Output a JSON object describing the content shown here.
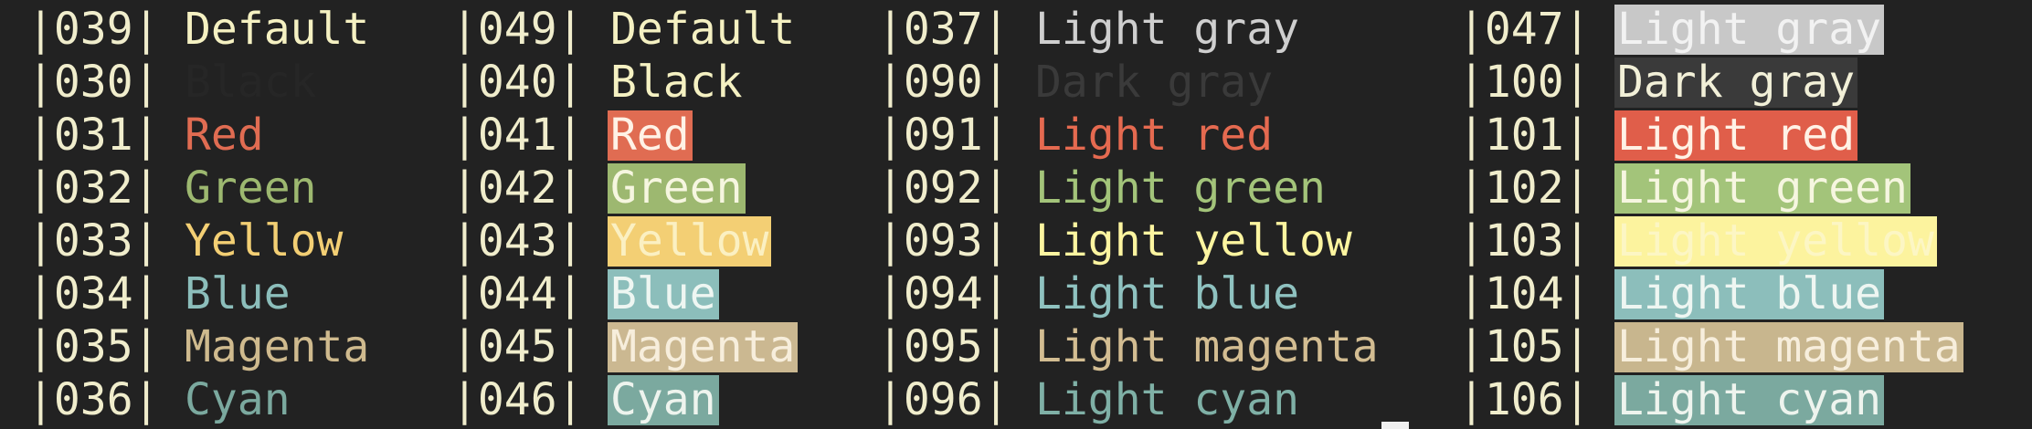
{
  "terminal": {
    "background": "#222222",
    "rows": [
      {
        "fg_code": "|039|",
        "fg_label": "Default",
        "fg_color": "#f5f1c2",
        "bg_code": "|049|",
        "bg_label": "Default",
        "bg_color": "#222222",
        "bg_text": "#f5f1c2",
        "lfg_code": "|037|",
        "lfg_label": "Light gray",
        "lfg_color": "#cfcfcf",
        "lbg_code": "|047|",
        "lbg_label": "Light gray",
        "lbg_color": "#c8c8c8",
        "lbg_text": "#f2f2f2"
      },
      {
        "fg_code": "|030|",
        "fg_label": "Black",
        "fg_color": "#262626",
        "bg_code": "|040|",
        "bg_label": "Black",
        "bg_color": "#222222",
        "bg_text": "#f5f1c2",
        "lfg_code": "|090|",
        "lfg_label": "Dark gray",
        "lfg_color": "#3a3a3a",
        "lbg_code": "|100|",
        "lbg_label": "Dark gray",
        "lbg_color": "#3a3a3a",
        "lbg_text": "#f2f0d8"
      },
      {
        "fg_code": "|031|",
        "fg_label": "Red",
        "fg_color": "#e06c52",
        "bg_code": "|041|",
        "bg_label": "Red",
        "bg_color": "#e06c52",
        "bg_text": "#fff2e6",
        "lfg_code": "|091|",
        "lfg_label": "Light red",
        "lfg_color": "#e56a50",
        "lbg_code": "|101|",
        "lbg_label": "Light red",
        "lbg_color": "#e05e4a",
        "lbg_text": "#fff2e6"
      },
      {
        "fg_code": "|032|",
        "fg_label": "Green",
        "fg_color": "#9db870",
        "bg_code": "|042|",
        "bg_label": "Green",
        "bg_color": "#9db870",
        "bg_text": "#f6f6e0",
        "lfg_code": "|092|",
        "lfg_label": "Light green",
        "lfg_color": "#a3c47a",
        "lbg_code": "|102|",
        "lbg_label": "Light green",
        "lbg_color": "#a3c47a",
        "lbg_text": "#f6f6e0"
      },
      {
        "fg_code": "|033|",
        "fg_label": "Yellow",
        "fg_color": "#f3cf74",
        "bg_code": "|043|",
        "bg_label": "Yellow",
        "bg_color": "#f3cf74",
        "bg_text": "#fbf0c2",
        "lfg_code": "|093|",
        "lfg_label": "Light yellow",
        "lfg_color": "#fdf5a0",
        "lbg_code": "|103|",
        "lbg_label": "Light yellow",
        "lbg_color": "#fcf39e",
        "lbg_text": "#fcf6c4"
      },
      {
        "fg_code": "|034|",
        "fg_label": "Blue",
        "fg_color": "#8cbebb",
        "bg_code": "|044|",
        "bg_label": "Blue",
        "bg_color": "#8cbebb",
        "bg_text": "#eef6f2",
        "lfg_code": "|094|",
        "lfg_label": "Light blue",
        "lfg_color": "#8fc2c0",
        "lbg_code": "|104|",
        "lbg_label": "Light blue",
        "lbg_color": "#8cbebb",
        "lbg_text": "#eef6f2"
      },
      {
        "fg_code": "|035|",
        "fg_label": "Magenta",
        "fg_color": "#cfba8e",
        "bg_code": "|045|",
        "bg_label": "Magenta",
        "bg_color": "#cbb891",
        "bg_text": "#f7eedc",
        "lfg_code": "|095|",
        "lfg_label": "Light magenta",
        "lfg_color": "#d3bd92",
        "lbg_code": "|105|",
        "lbg_label": "Light magenta",
        "lbg_color": "#c8b68e",
        "lbg_text": "#f7eedc"
      },
      {
        "fg_code": "|036|",
        "fg_label": "Cyan",
        "fg_color": "#7ba99f",
        "bg_code": "|046|",
        "bg_label": "Cyan",
        "bg_color": "#7ba99f",
        "bg_text": "#eef4ee",
        "lfg_code": "|096|",
        "lfg_label": "Light cyan",
        "lfg_color": "#7fb0a6",
        "lbg_code": "|106|",
        "lbg_label": "Light cyan",
        "lbg_color": "#7ba99f",
        "lbg_text": "#eef4ee"
      }
    ]
  }
}
